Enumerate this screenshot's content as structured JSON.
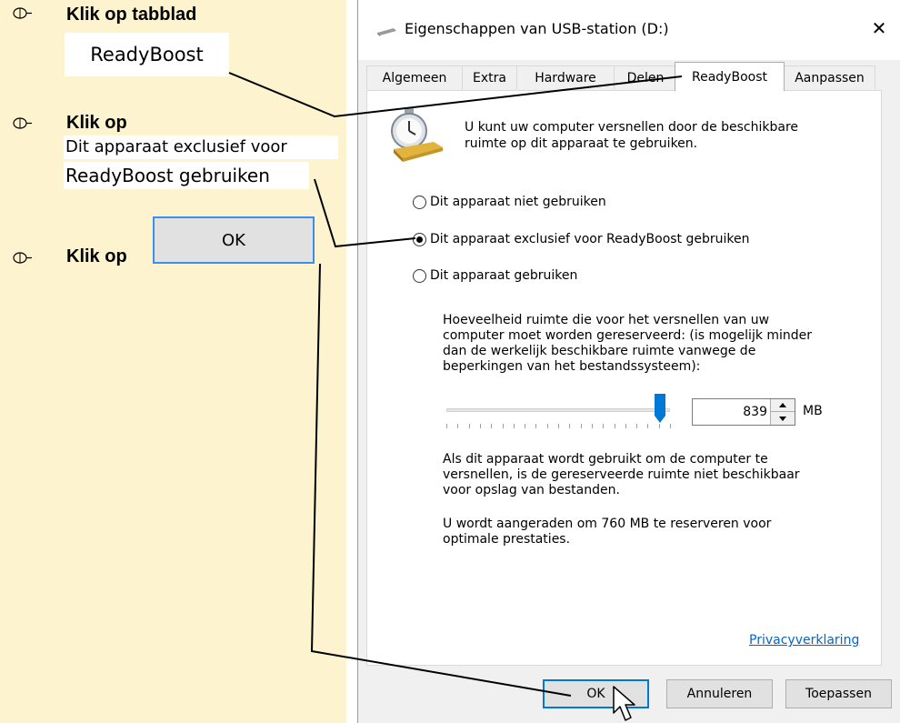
{
  "instructions": {
    "step1_label": "Klik op tabblad",
    "step1_callout": "ReadyBoost",
    "step2_label": "Klik op",
    "step2_callout_line1": "Dit apparaat exclusief voor",
    "step2_callout_line2": "ReadyBoost gebruiken",
    "step3_label": "Klik op",
    "step3_button": "OK"
  },
  "dialog": {
    "title": "Eigenschappen van USB-station (D:)",
    "close_glyph": "✕",
    "tabs": [
      "Algemeen",
      "Extra",
      "Hardware",
      "Delen",
      "ReadyBoost",
      "Aanpassen"
    ],
    "active_tab": "ReadyBoost",
    "intro_line1": "U kunt uw computer versnellen door de beschikbare",
    "intro_line2": "ruimte op dit apparaat te gebruiken.",
    "options": [
      {
        "label": "Dit apparaat niet gebruiken",
        "checked": false
      },
      {
        "label": "Dit apparaat exclusief voor ReadyBoost gebruiken",
        "checked": true
      },
      {
        "label": "Dit apparaat gebruiken",
        "checked": false
      }
    ],
    "reserve_text": [
      "Hoeveelheid ruimte die voor het versnellen van uw",
      "computer moet worden gereserveerd: (is mogelijk minder",
      "dan de werkelijk beschikbare ruimte vanwege de",
      "beperkingen van het bestandssysteem):"
    ],
    "slider_fraction": 0.98,
    "spin_value": "839",
    "unit": "MB",
    "note_text": [
      "Als dit apparaat wordt gebruikt om de computer te",
      "versnellen, is de gereserveerde ruimte niet beschikbaar",
      "voor opslag van bestanden."
    ],
    "recommend_text": [
      "U wordt aangeraden om 760 MB te reserveren voor",
      "optimale prestaties."
    ],
    "privacy_link": "Privacyverklaring",
    "buttons": {
      "ok": "OK",
      "cancel": "Annuleren",
      "apply": "Toepassen"
    }
  },
  "colors": {
    "panel_bg": "#fdf3cf",
    "accent": "#0078d7",
    "link": "#0066cc"
  }
}
